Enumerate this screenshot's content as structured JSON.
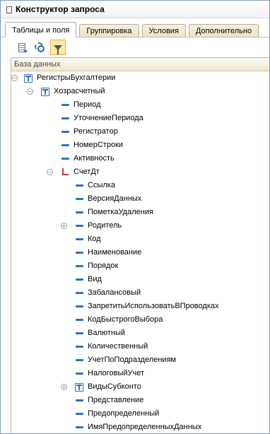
{
  "window": {
    "title": "Конструктор запроса"
  },
  "tabs": [
    {
      "label": "Таблицы и поля",
      "active": true
    },
    {
      "label": "Группировка",
      "active": false
    },
    {
      "label": "Условия",
      "active": false
    },
    {
      "label": "Дополнительно",
      "active": false
    }
  ],
  "toolbar": {
    "buttons": [
      {
        "icon": "list-icon",
        "active": false
      },
      {
        "icon": "gear-icon",
        "active": false
      },
      {
        "icon": "filter-icon",
        "active": true
      }
    ]
  },
  "tree": {
    "column_header": "База данных",
    "rows": [
      {
        "label": "РегистрыБухгалтерии",
        "level": 0,
        "icon": "table-icon",
        "expander": "collapse"
      },
      {
        "label": "Хозрасчетный",
        "level": 1,
        "icon": "table-icon",
        "expander": "collapse"
      },
      {
        "label": "Период",
        "level": 2,
        "icon": "field-icon",
        "expander": ""
      },
      {
        "label": "УточнениеПериода",
        "level": 2,
        "icon": "field-icon",
        "expander": ""
      },
      {
        "label": "Регистратор",
        "level": 2,
        "icon": "field-icon",
        "expander": ""
      },
      {
        "label": "НомерСтроки",
        "level": 2,
        "icon": "field-icon",
        "expander": ""
      },
      {
        "label": "Активность",
        "level": 2,
        "icon": "field-icon",
        "expander": ""
      },
      {
        "label": "СчетДт",
        "level": 2,
        "icon": "account-icon",
        "expander": "collapse"
      },
      {
        "label": "Ссылка",
        "level": 3,
        "icon": "field-icon",
        "expander": ""
      },
      {
        "label": "ВерсияДанных",
        "level": 3,
        "icon": "field-icon",
        "expander": ""
      },
      {
        "label": "ПометкаУдаления",
        "level": 3,
        "icon": "field-icon",
        "expander": ""
      },
      {
        "label": "Родитель",
        "level": 3,
        "icon": "field-icon",
        "expander": "expand"
      },
      {
        "label": "Код",
        "level": 3,
        "icon": "field-icon",
        "expander": ""
      },
      {
        "label": "Наименование",
        "level": 3,
        "icon": "field-icon",
        "expander": ""
      },
      {
        "label": "Порядок",
        "level": 3,
        "icon": "field-icon",
        "expander": ""
      },
      {
        "label": "Вид",
        "level": 3,
        "icon": "field-icon",
        "expander": ""
      },
      {
        "label": "Забалансовый",
        "level": 3,
        "icon": "field-icon",
        "expander": ""
      },
      {
        "label": "ЗапретитьИспользоватьВПроводках",
        "level": 3,
        "icon": "field-icon",
        "expander": ""
      },
      {
        "label": "КодБыстрогоВыбора",
        "level": 3,
        "icon": "field-icon",
        "expander": ""
      },
      {
        "label": "Валютный",
        "level": 3,
        "icon": "field-icon",
        "expander": ""
      },
      {
        "label": "Количественный",
        "level": 3,
        "icon": "field-icon",
        "expander": ""
      },
      {
        "label": "УчетПоПодразделениям",
        "level": 3,
        "icon": "field-icon",
        "expander": ""
      },
      {
        "label": "НалоговыйУчет",
        "level": 3,
        "icon": "field-icon",
        "expander": ""
      },
      {
        "label": "ВидыСубконто",
        "level": 3,
        "icon": "table-icon",
        "expander": "expand"
      },
      {
        "label": "Представление",
        "level": 3,
        "icon": "field-icon",
        "expander": ""
      },
      {
        "label": "Предопределенный",
        "level": 3,
        "icon": "field-icon",
        "expander": ""
      },
      {
        "label": "ИмяПредопределенныхДанных",
        "level": 3,
        "icon": "field-icon",
        "expander": ""
      }
    ]
  }
}
